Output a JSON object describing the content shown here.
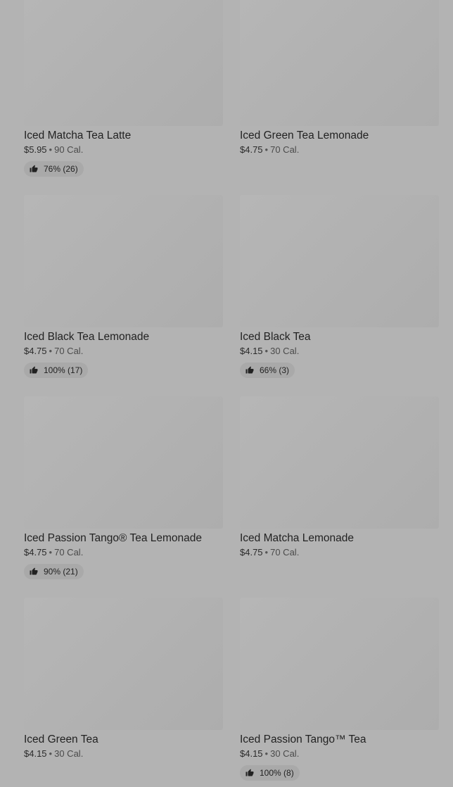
{
  "products": [
    {
      "name": "Iced Matcha Tea Latte",
      "price": "$5.95",
      "calories": "90 Cal.",
      "rating": "76% (26)"
    },
    {
      "name": "Iced Green Tea Lemonade",
      "price": "$4.75",
      "calories": "70 Cal.",
      "rating": null
    },
    {
      "name": "Iced Black Tea Lemonade",
      "price": "$4.75",
      "calories": "70 Cal.",
      "rating": "100% (17)"
    },
    {
      "name": "Iced Black Tea",
      "price": "$4.15",
      "calories": "30 Cal.",
      "rating": "66% (3)"
    },
    {
      "name": "Iced Passion Tango® Tea Lemonade",
      "price": "$4.75",
      "calories": "70 Cal.",
      "rating": "90% (21)"
    },
    {
      "name": "Iced Matcha Lemonade",
      "price": "$4.75",
      "calories": "70 Cal.",
      "rating": null
    },
    {
      "name": "Iced Green Tea",
      "price": "$4.15",
      "calories": "30 Cal.",
      "rating": null
    },
    {
      "name": "Iced Passion Tango™ Tea",
      "price": "$4.15",
      "calories": "30 Cal.",
      "rating": "100% (8)"
    }
  ],
  "separator": "•",
  "rating_icon": "thumbs-up-icon",
  "colors": {
    "background": "#b3b3b3",
    "thumbnail": "#b1b1b1",
    "rating_pill": "#a9a9a9",
    "text": "#222222"
  }
}
